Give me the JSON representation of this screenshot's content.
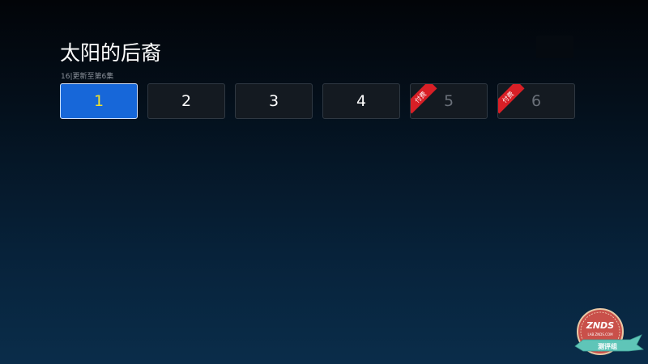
{
  "show": {
    "title": "太阳的后裔",
    "subtitle": "16|更新至第6集"
  },
  "episodes": [
    {
      "number": "1",
      "selected": true,
      "paid": false
    },
    {
      "number": "2",
      "selected": false,
      "paid": false
    },
    {
      "number": "3",
      "selected": false,
      "paid": false
    },
    {
      "number": "4",
      "selected": false,
      "paid": false
    },
    {
      "number": "5",
      "selected": false,
      "paid": true,
      "badge": "付费"
    },
    {
      "number": "6",
      "selected": false,
      "paid": true,
      "badge": "付费"
    }
  ],
  "watermark": {
    "brand": "ZNDS",
    "url": "LAB.ZNDS.COM",
    "tagline": "测评组"
  },
  "colors": {
    "selected_bg": "#1767d9",
    "selected_text": "#f2e22b",
    "paid_badge": "#d81f26"
  }
}
